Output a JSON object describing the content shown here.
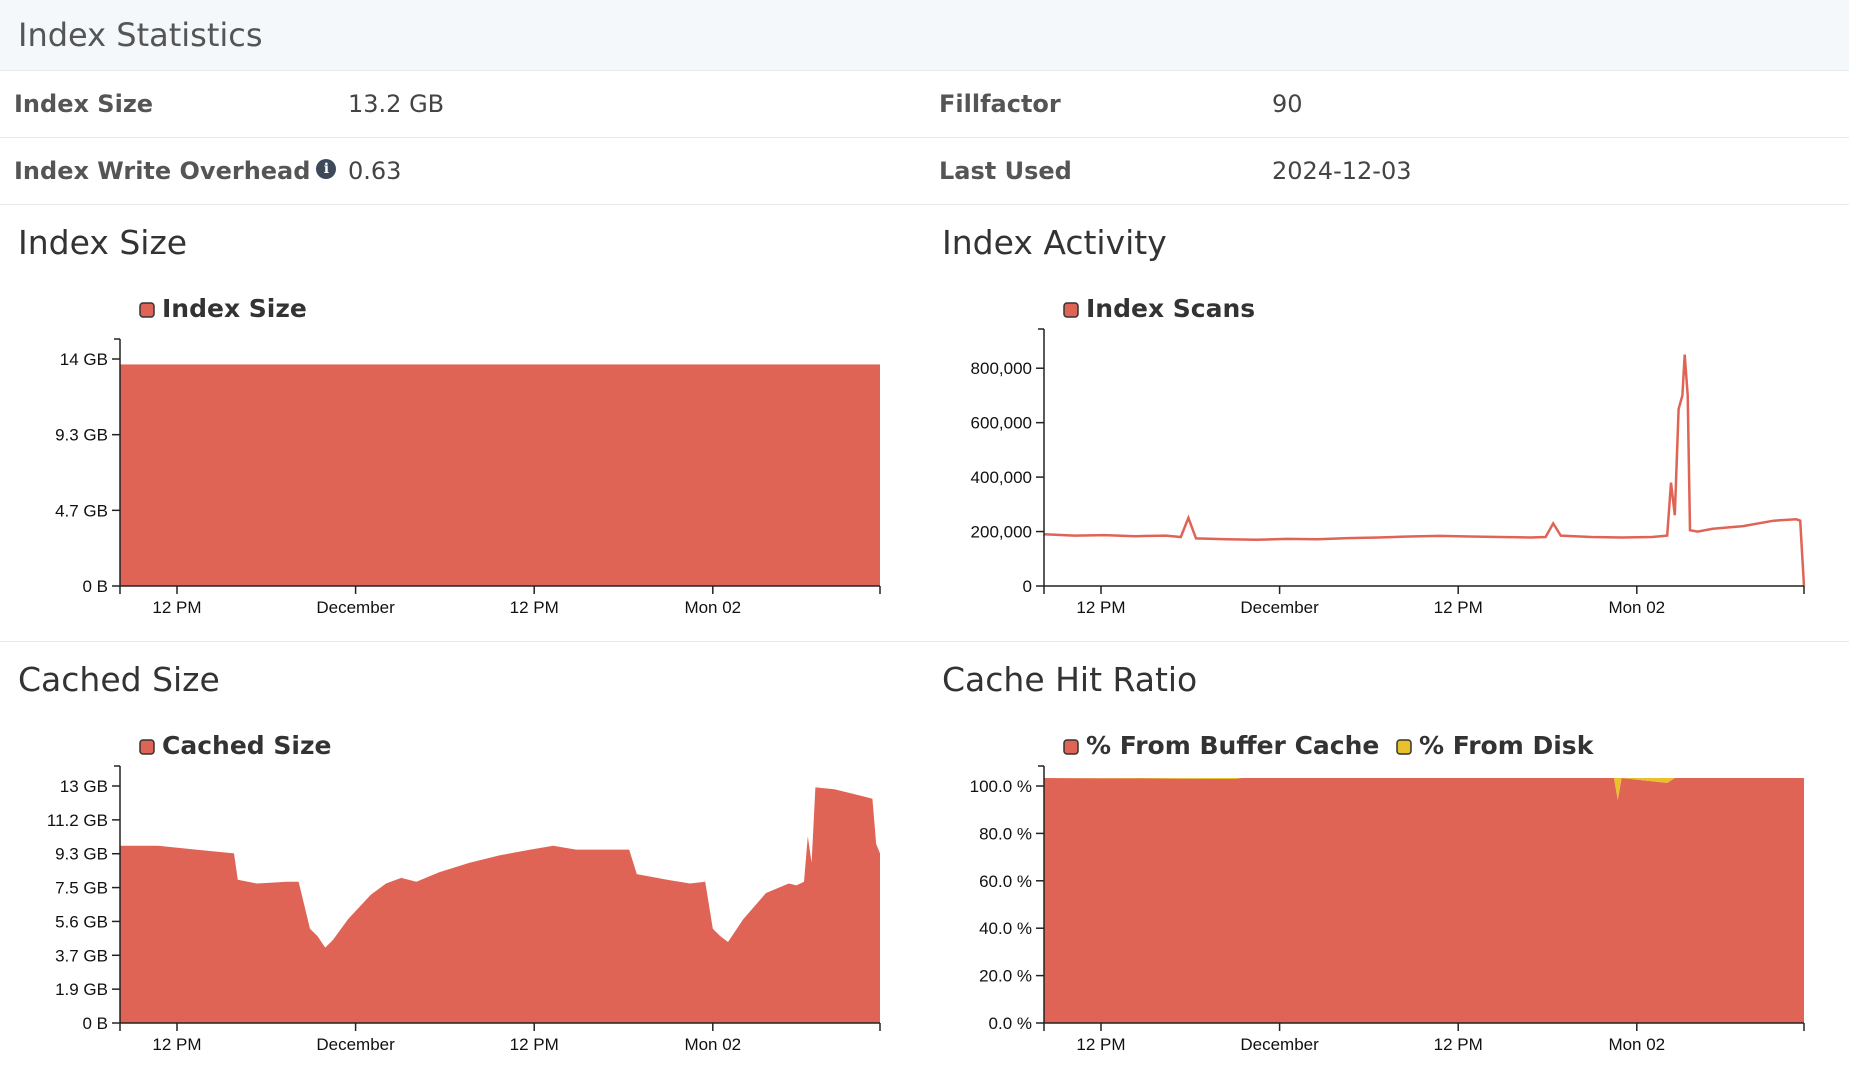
{
  "page": {
    "title": "Index Statistics"
  },
  "stats": {
    "index_size_label": "Index Size",
    "index_size_value": "13.2 GB",
    "fillfactor_label": "Fillfactor",
    "fillfactor_value": "90",
    "write_overhead_label": "Index Write Overhead",
    "write_overhead_value": "0.63",
    "last_used_label": "Last Used",
    "last_used_value": "2024-12-03"
  },
  "colors": {
    "red": "#e06456",
    "yellow": "#e8c12b"
  },
  "charts": {
    "index_size": {
      "title": "Index Size"
    },
    "index_activity": {
      "title": "Index Activity"
    },
    "cached_size": {
      "title": "Cached Size"
    },
    "cache_hit": {
      "title": "Cache Hit Ratio"
    }
  },
  "chart_data": [
    {
      "id": "index_size",
      "type": "area",
      "title": "Index Size",
      "legend": [
        "Index Size"
      ],
      "x_ticks": [
        "12 PM",
        "December",
        "12 PM",
        "Mon 02"
      ],
      "y_ticks": [
        "0 B",
        "4.7 GB",
        "9.3 GB",
        "14 GB"
      ],
      "ylim": [
        0,
        14
      ],
      "y_unit": "GB",
      "series": [
        {
          "name": "Index Size",
          "values": [
            13.2,
            13.2,
            13.2,
            13.2,
            13.2,
            13.2,
            13.2,
            13.2,
            13.2,
            13.2,
            13.2,
            13.2
          ]
        }
      ]
    },
    {
      "id": "index_activity",
      "type": "line",
      "title": "Index Activity",
      "legend": [
        "Index Scans"
      ],
      "x_ticks": [
        "12 PM",
        "December",
        "12 PM",
        "Mon 02"
      ],
      "y_ticks": [
        "0",
        "200,000",
        "400,000",
        "600,000",
        "800,000"
      ],
      "ylim": [
        0,
        900000
      ],
      "series": [
        {
          "name": "Index Scans",
          "points": [
            [
              0,
              190000
            ],
            [
              0.04,
              185000
            ],
            [
              0.08,
              187000
            ],
            [
              0.12,
              183000
            ],
            [
              0.16,
              185000
            ],
            [
              0.18,
              180000
            ],
            [
              0.19,
              250000
            ],
            [
              0.2,
              175000
            ],
            [
              0.24,
              172000
            ],
            [
              0.28,
              170000
            ],
            [
              0.32,
              173000
            ],
            [
              0.36,
              172000
            ],
            [
              0.4,
              176000
            ],
            [
              0.44,
              178000
            ],
            [
              0.48,
              182000
            ],
            [
              0.52,
              184000
            ],
            [
              0.56,
              182000
            ],
            [
              0.6,
              180000
            ],
            [
              0.64,
              178000
            ],
            [
              0.66,
              180000
            ],
            [
              0.67,
              230000
            ],
            [
              0.68,
              185000
            ],
            [
              0.72,
              180000
            ],
            [
              0.76,
              178000
            ],
            [
              0.8,
              180000
            ],
            [
              0.82,
              185000
            ],
            [
              0.825,
              380000
            ],
            [
              0.83,
              260000
            ],
            [
              0.835,
              650000
            ],
            [
              0.84,
              700000
            ],
            [
              0.843,
              850000
            ],
            [
              0.847,
              700000
            ],
            [
              0.85,
              205000
            ],
            [
              0.86,
              200000
            ],
            [
              0.88,
              210000
            ],
            [
              0.92,
              220000
            ],
            [
              0.96,
              240000
            ],
            [
              0.99,
              245000
            ],
            [
              0.995,
              240000
            ],
            [
              1.0,
              0
            ]
          ]
        }
      ]
    },
    {
      "id": "cached_size",
      "type": "area",
      "title": "Cached Size",
      "legend": [
        "Cached Size"
      ],
      "x_ticks": [
        "12 PM",
        "December",
        "12 PM",
        "Mon 02"
      ],
      "y_ticks": [
        "0 B",
        "1.9 GB",
        "3.7 GB",
        "5.6 GB",
        "7.5 GB",
        "9.3 GB",
        "11.2 GB",
        "13 GB"
      ],
      "ylim": [
        0,
        13
      ],
      "y_unit": "GB",
      "series": [
        {
          "name": "Cached Size",
          "points": [
            [
              0,
              9.4
            ],
            [
              0.05,
              9.4
            ],
            [
              0.1,
              9.2
            ],
            [
              0.15,
              9.0
            ],
            [
              0.155,
              7.6
            ],
            [
              0.18,
              7.4
            ],
            [
              0.22,
              7.5
            ],
            [
              0.235,
              7.5
            ],
            [
              0.25,
              5.0
            ],
            [
              0.26,
              4.6
            ],
            [
              0.27,
              4.0
            ],
            [
              0.28,
              4.4
            ],
            [
              0.3,
              5.5
            ],
            [
              0.33,
              6.8
            ],
            [
              0.35,
              7.4
            ],
            [
              0.37,
              7.7
            ],
            [
              0.39,
              7.5
            ],
            [
              0.42,
              8.0
            ],
            [
              0.46,
              8.5
            ],
            [
              0.5,
              8.9
            ],
            [
              0.54,
              9.2
            ],
            [
              0.57,
              9.4
            ],
            [
              0.6,
              9.2
            ],
            [
              0.64,
              9.2
            ],
            [
              0.67,
              9.2
            ],
            [
              0.68,
              7.9
            ],
            [
              0.72,
              7.6
            ],
            [
              0.75,
              7.4
            ],
            [
              0.77,
              7.5
            ],
            [
              0.78,
              5.0
            ],
            [
              0.79,
              4.6
            ],
            [
              0.8,
              4.3
            ],
            [
              0.82,
              5.5
            ],
            [
              0.85,
              6.9
            ],
            [
              0.88,
              7.4
            ],
            [
              0.89,
              7.3
            ],
            [
              0.9,
              7.5
            ],
            [
              0.905,
              9.9
            ],
            [
              0.91,
              8.5
            ],
            [
              0.915,
              12.5
            ],
            [
              0.94,
              12.4
            ],
            [
              0.98,
              12.0
            ],
            [
              0.99,
              11.9
            ],
            [
              0.995,
              9.5
            ],
            [
              1.0,
              9.0
            ]
          ]
        }
      ]
    },
    {
      "id": "cache_hit",
      "type": "area",
      "title": "Cache Hit Ratio",
      "legend": [
        "% From Buffer Cache",
        "% From Disk"
      ],
      "x_ticks": [
        "12 PM",
        "December",
        "12 PM",
        "Mon 02"
      ],
      "y_ticks": [
        "0.0 %",
        "20.0 %",
        "40.0 %",
        "60.0 %",
        "80.0 %",
        "100.0 %"
      ],
      "ylim": [
        0,
        100
      ],
      "series": [
        {
          "name": "% From Buffer Cache",
          "points": [
            [
              0,
              100
            ],
            [
              0.25,
              99.6
            ],
            [
              0.26,
              100
            ],
            [
              0.75,
              100
            ],
            [
              0.755,
              91
            ],
            [
              0.76,
              100
            ],
            [
              0.82,
              98
            ],
            [
              0.83,
              100
            ],
            [
              1.0,
              100
            ]
          ]
        },
        {
          "name": "% From Disk",
          "points": [
            [
              0,
              0
            ],
            [
              0.25,
              0.4
            ],
            [
              0.26,
              0
            ],
            [
              0.75,
              0
            ],
            [
              0.755,
              9
            ],
            [
              0.76,
              0
            ],
            [
              0.82,
              2
            ],
            [
              0.83,
              0
            ],
            [
              1.0,
              0
            ]
          ]
        }
      ]
    }
  ]
}
